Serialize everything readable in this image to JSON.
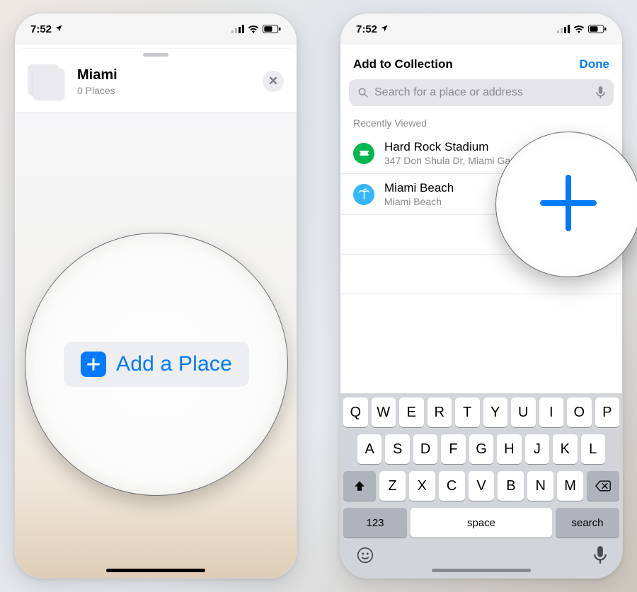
{
  "status": {
    "time": "7:52",
    "location_icon": "location-arrow"
  },
  "left": {
    "collection_title": "Miami",
    "collection_subtitle": "0 Places",
    "add_place_label": "Add a Place"
  },
  "right": {
    "nav_title": "Add to Collection",
    "done_label": "Done",
    "search_placeholder": "Search for a place or address",
    "section_header": "Recently Viewed",
    "rows": [
      {
        "title": "Hard Rock Stadium",
        "subtitle": "347 Don Shula Dr, Miami Gardens",
        "icon": "ticket",
        "icon_color": "green"
      },
      {
        "title": "Miami Beach",
        "subtitle": "Miami Beach",
        "icon": "palm",
        "icon_color": "blue"
      }
    ]
  },
  "keyboard": {
    "r1": [
      "Q",
      "W",
      "E",
      "R",
      "T",
      "Y",
      "U",
      "I",
      "O",
      "P"
    ],
    "r2": [
      "A",
      "S",
      "D",
      "F",
      "G",
      "H",
      "J",
      "K",
      "L"
    ],
    "r3": [
      "Z",
      "X",
      "C",
      "V",
      "B",
      "N",
      "M"
    ],
    "k123": "123",
    "space": "space",
    "search": "search"
  },
  "magnified_plus_icon": "plus-icon"
}
